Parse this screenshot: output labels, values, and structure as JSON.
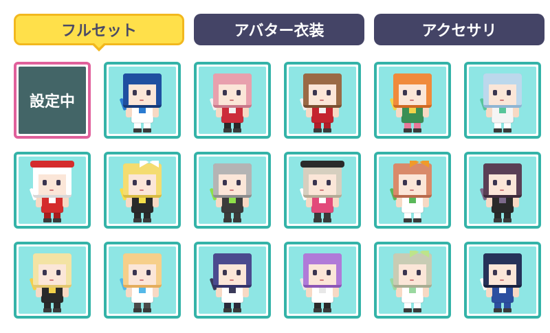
{
  "tabs": [
    {
      "label": "フルセット",
      "active": true
    },
    {
      "label": "アバター衣装",
      "active": false
    },
    {
      "label": "アクセサリ",
      "active": false
    }
  ],
  "selected_label": "設定中",
  "colors": {
    "active_tab": "#ffe04a",
    "inactive_tab": "#444466",
    "cell_border": "#34b3a8",
    "cell_bg": "#8ee6e4",
    "selected_border": "#e0609b",
    "selected_bg": "#436567"
  },
  "avatars": [
    {
      "hair": "#1f4fa0",
      "hair_shade": "#163b7a",
      "outfit": "#ffffff",
      "accent": "#2a7bd1",
      "legs": "#ffffff"
    },
    {
      "hair": "#e8a0ad",
      "hair_shade": "#c9798a",
      "outfit": "#cc2c3a",
      "accent": "#f2f2f2",
      "legs": "#2a2a2a"
    },
    {
      "hair": "#9a6a45",
      "hair_shade": "#7a5033",
      "outfit": "#c4232e",
      "accent": "#f2f2f2",
      "legs": "#b01f2a"
    },
    {
      "hair": "#f08a3c",
      "hair_shade": "#d06a24",
      "outfit": "#3a8f55",
      "accent": "#f2d34a",
      "legs": "#e87a9a"
    },
    {
      "hair": "#bcd8ec",
      "hair_shade": "#8fb5d3",
      "outfit": "#f5f5f5",
      "accent": "#57c59a",
      "legs": "#ffffff"
    },
    {
      "hair": "#ffffff",
      "hair_shade": "#d8d8d8",
      "outfit": "#d42c2c",
      "accent": "#ffffff",
      "legs": "#a81e1e",
      "hat": "#d42c2c"
    },
    {
      "hair": "#f4dc70",
      "hair_shade": "#d9bc44",
      "outfit": "#2a2a2a",
      "accent": "#f6df4a",
      "legs": "#2a2a2a",
      "bow": "#ffffff"
    },
    {
      "hair": "#b4b4b4",
      "hair_shade": "#8e8e8e",
      "outfit": "#3b3b3b",
      "accent": "#8ee04a",
      "legs": "#3b3b3b"
    },
    {
      "hair": "#d6cfbf",
      "hair_shade": "#b5ab97",
      "outfit": "#e24a7a",
      "accent": "#ffffff",
      "legs": "#3a3a3a",
      "hat": "#2a2a2a"
    },
    {
      "hair": "#d98a6a",
      "hair_shade": "#b86a4c",
      "outfit": "#ffffff",
      "accent": "#5ab85a",
      "legs": "#ffffff",
      "bow": "#f09a2a"
    },
    {
      "hair": "#5a3f55",
      "hair_shade": "#3f2b3b",
      "outfit": "#2a2a2a",
      "accent": "#7c6a8a",
      "legs": "#2a2a2a"
    },
    {
      "hair": "#f3e3a4",
      "hair_shade": "#e4c870",
      "outfit": "#2a2a2a",
      "accent": "#f2d04a",
      "legs": "#2a2a2a"
    },
    {
      "hair": "#f6cf8a",
      "hair_shade": "#e4ad5c",
      "outfit": "#ffffff",
      "accent": "#55b8e8",
      "legs": "#4a4a4a"
    },
    {
      "hair": "#4b4a8e",
      "hair_shade": "#34336a",
      "outfit": "#ffffff",
      "accent": "#3a3a5a",
      "legs": "#2a2a3a"
    },
    {
      "hair": "#b07ad8",
      "hair_shade": "#8c56b6",
      "outfit": "#ffffff",
      "accent": "#e8e8e8",
      "legs": "#2a2a2a"
    },
    {
      "hair": "#c8ccb4",
      "hair_shade": "#a8ad92",
      "outfit": "#ffffff",
      "accent": "#9ad8a0",
      "legs": "#ffffff",
      "bow": "#bde48a"
    },
    {
      "hair": "#263259",
      "hair_shade": "#1a2240",
      "outfit": "#2c4fa0",
      "accent": "#ffffff",
      "legs": "#2c4fa0"
    }
  ]
}
